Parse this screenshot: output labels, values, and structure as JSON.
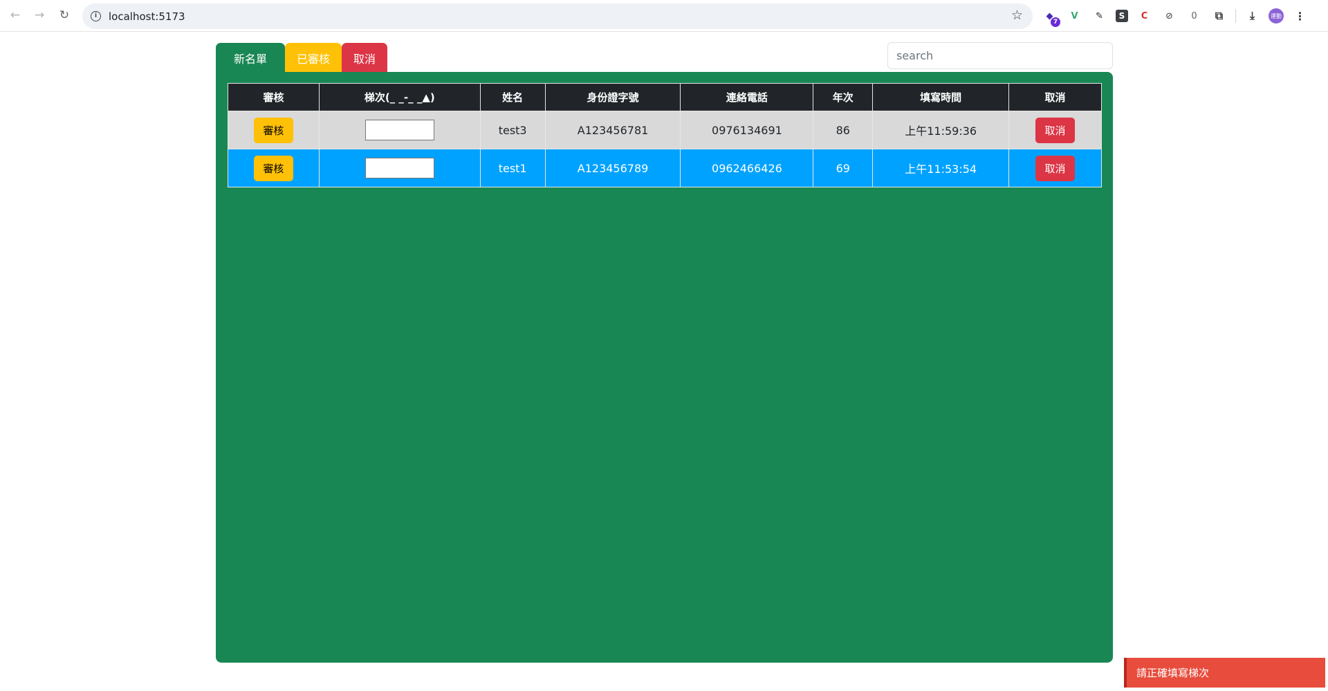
{
  "browser": {
    "url": "localhost:5173",
    "extension_badge": "7",
    "profile_label": "運動"
  },
  "tabs": [
    {
      "label": "新名單",
      "color": "#198754"
    },
    {
      "label": "已審核",
      "color": "#ffc107"
    },
    {
      "label": "取消",
      "color": "#dc3545"
    }
  ],
  "search": {
    "placeholder": "search",
    "value": ""
  },
  "table": {
    "headers": [
      "審核",
      "梯次(_ _-_ _▲)",
      "姓名",
      "身份證字號",
      "連絡電話",
      "年次",
      "填寫時間",
      "取消"
    ],
    "rows": [
      {
        "approve_label": "審核",
        "level": "",
        "name": "test3",
        "id_number": "A123456781",
        "phone": "0976134691",
        "birth_year": "86",
        "time": "上午11:59:36",
        "cancel_label": "取消"
      },
      {
        "approve_label": "審核",
        "level": "",
        "name": "test1",
        "id_number": "A123456789",
        "phone": "0962466426",
        "birth_year": "69",
        "time": "上午11:53:54",
        "cancel_label": "取消"
      }
    ]
  },
  "toast": {
    "message": "請正確填寫梯次"
  },
  "colors": {
    "panel": "#198754",
    "row_selected": "#00a2ff",
    "row_default": "#d9d9d9",
    "approve_button": "#ffc107",
    "cancel_button": "#dc3545",
    "toast": "#e74c3c"
  }
}
